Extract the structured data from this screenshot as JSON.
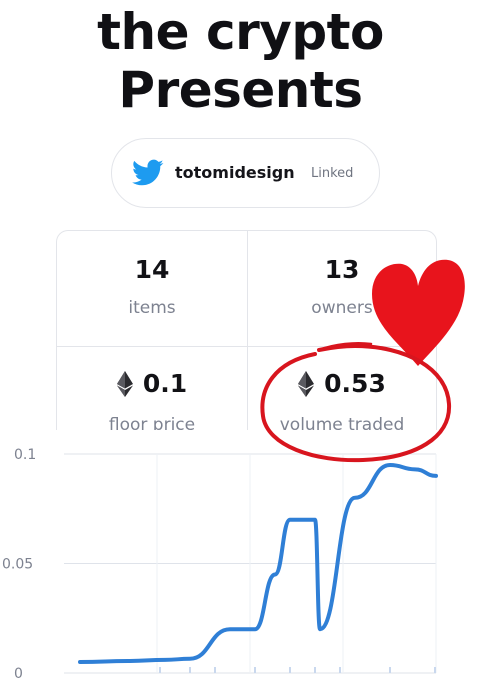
{
  "header": {
    "title_line1": "the crypto",
    "title_line2": "Presents"
  },
  "account": {
    "icon": "twitter-bird-icon",
    "handle": "totomidesign",
    "status": "Linked",
    "brand_color": "#1d9bf0"
  },
  "stats": [
    {
      "value": "14",
      "label": "items",
      "icon": ""
    },
    {
      "value": "13",
      "label": "owners",
      "icon": ""
    },
    {
      "value": "0.1",
      "label": "floor price",
      "icon": "ethereum-icon"
    },
    {
      "value": "0.53",
      "label": "volume traded",
      "icon": "ethereum-icon"
    }
  ],
  "annotations": {
    "heart_color": "#e8141c",
    "circle_color": "#d8151e"
  },
  "chart_data": {
    "type": "line",
    "y_ticks": [
      "0.1",
      "0.05",
      "0"
    ],
    "ylim": [
      0,
      0.1
    ],
    "grid": true,
    "line_color": "#2f7fd6",
    "series": [
      {
        "values": [
          0.005,
          0.0055,
          0.006,
          0.0065,
          0.02,
          0.02,
          0.045,
          0.07,
          0.07,
          0.02,
          0.08,
          0.095,
          0.093,
          0.09
        ]
      }
    ]
  }
}
